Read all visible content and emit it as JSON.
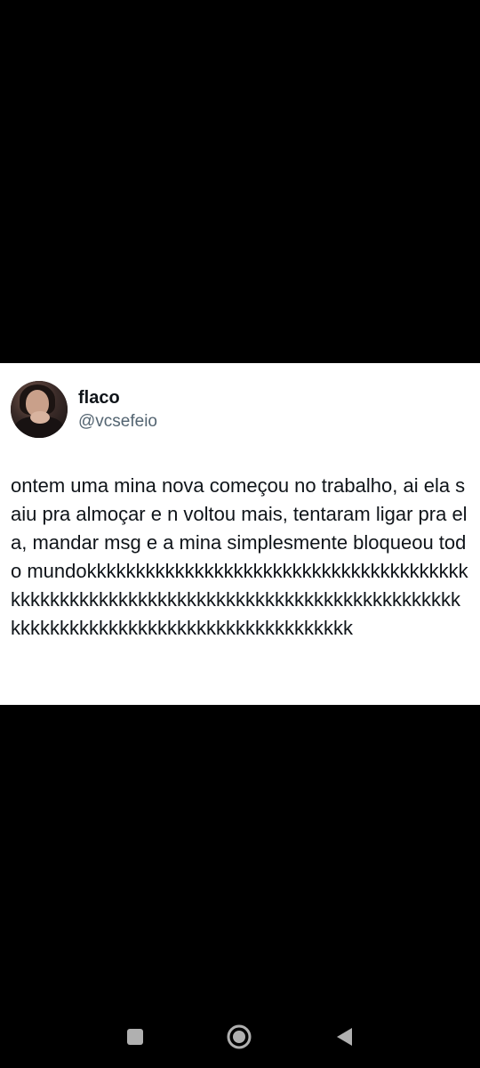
{
  "tweet": {
    "display_name": "flaco",
    "handle": "@vcsefeio",
    "text": "ontem uma mina nova começou no trabalho, ai ela saiu pra almoçar e n voltou mais, tentaram ligar pra ela, mandar msg e a mina simplesmente bloqueou todo mundokkkkkkkkkkkkkkkkkkkkkkkkkkkkkkkkkkkkkkkkkkkkkkkkkkkkkkkkkkkkkkkkkkkkkkkkkkkkkkkkkkkkkkkkkkkkkkkkkkkkkkkkkkkkkkkkkkkkkkkk",
    "avatar_icon": "profile-photo"
  },
  "nav_bar": {
    "recents_icon": "square-icon",
    "home_icon": "circle-home-icon",
    "back_icon": "triangle-back-icon",
    "icon_color": "#b0b0b0"
  },
  "colors": {
    "background": "#000000",
    "card": "#ffffff",
    "text_primary": "#0f1419",
    "text_secondary": "#536471"
  }
}
